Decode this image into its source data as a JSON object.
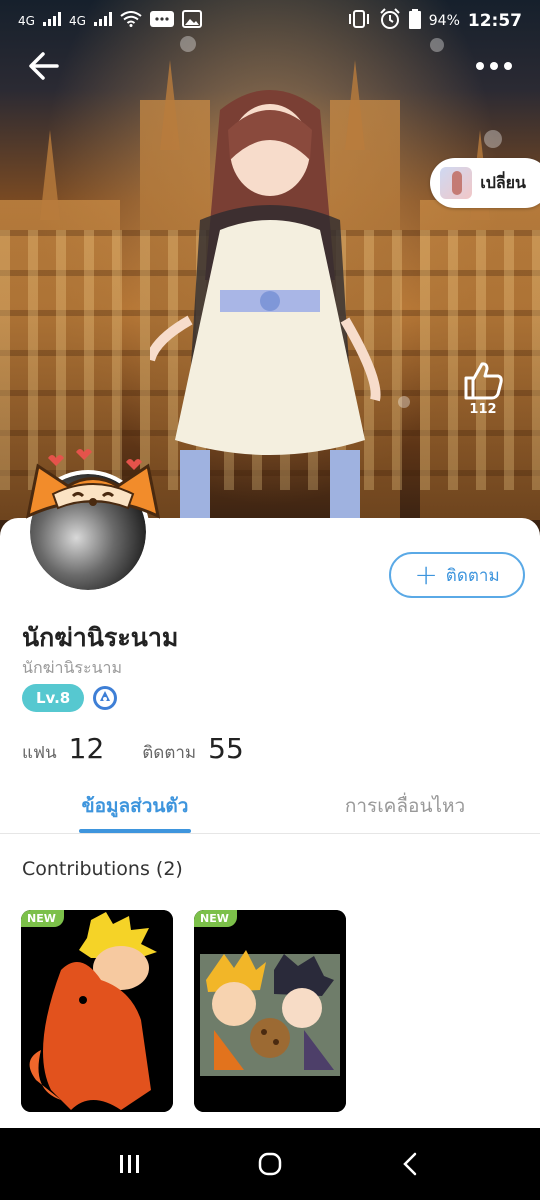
{
  "status_bar": {
    "network_1": "4G",
    "network_2": "4G",
    "battery": "94%",
    "time": "12:57"
  },
  "hero": {
    "change_label": "เปลี่ยน",
    "like_count": "112"
  },
  "profile": {
    "name": "นักฆ่านิระนาม",
    "handle": "นักฆ่านิระนาม",
    "level": "Lv.8",
    "follow_label": "ติดตาม",
    "fans_label": "แฟน",
    "fans_value": "12",
    "following_label": "ติดตาม",
    "following_value": "55"
  },
  "tabs": [
    {
      "label": "ข้อมูลส่วนตัว",
      "active": true
    },
    {
      "label": "การเคลื่อนไหว",
      "active": false
    }
  ],
  "contributions": {
    "title": "Contributions (2)",
    "items": [
      {
        "tag": "NEW"
      },
      {
        "tag": "NEW"
      }
    ]
  },
  "colors": {
    "accent": "#3e95dd",
    "level_badge": "#56c8d0",
    "new_tag": "#7cc04a"
  }
}
